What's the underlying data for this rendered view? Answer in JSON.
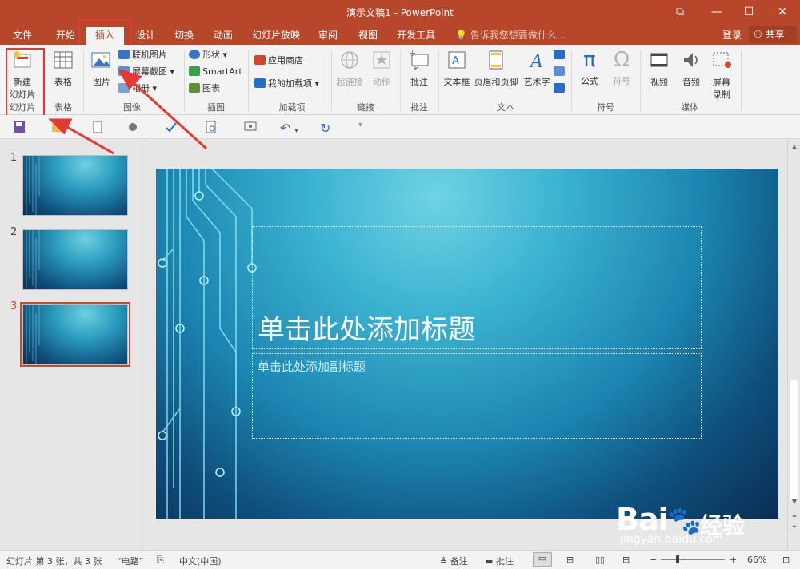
{
  "window": {
    "title": "演示文稿1 - PowerPoint",
    "controls": [
      "⧉",
      "—",
      "☐",
      "✕"
    ]
  },
  "tabs": [
    {
      "label": "文件",
      "active": false
    },
    {
      "label": "开始",
      "active": false
    },
    {
      "label": "插入",
      "active": true
    },
    {
      "label": "设计",
      "active": false
    },
    {
      "label": "切换",
      "active": false
    },
    {
      "label": "动画",
      "active": false
    },
    {
      "label": "幻灯片放映",
      "active": false
    },
    {
      "label": "审阅",
      "active": false
    },
    {
      "label": "视图",
      "active": false
    },
    {
      "label": "开发工具",
      "active": false
    }
  ],
  "tellme": "告诉我您想要做什么...",
  "login": "登录",
  "share": "共享",
  "ribbon": {
    "slides": {
      "new_slide": "新建\n幻灯片",
      "new_slide_line1": "新建",
      "new_slide_line2": "幻灯片",
      "group": "幻灯片"
    },
    "tables": {
      "table": "表格",
      "group": "表格"
    },
    "images": {
      "picture": "图片",
      "online": "联机图片",
      "screenshot": "屏幕截图",
      "album": "相册",
      "group": "图像"
    },
    "illustrations": {
      "shapes": "形状",
      "smartart": "SmartArt",
      "chart": "图表",
      "group": "插图"
    },
    "addins": {
      "store": "应用商店",
      "my_addins": "我的加载项",
      "group": "加载项"
    },
    "links": {
      "hyperlink": "超链接",
      "action": "动作",
      "group": "链接"
    },
    "comments": {
      "comment": "批注",
      "group": "批注"
    },
    "text": {
      "textbox": "文本框",
      "header_footer": "页眉和页脚",
      "wordart": "艺术字",
      "group": "文本"
    },
    "symbols": {
      "equation": "公式",
      "symbol": "符号",
      "group": "符号"
    },
    "media": {
      "video": "视频",
      "audio": "音频",
      "screen_rec_1": "屏幕",
      "screen_rec_2": "录制",
      "group": "媒体"
    }
  },
  "thumbnails": [
    {
      "number": "1",
      "selected": false
    },
    {
      "number": "2",
      "selected": false
    },
    {
      "number": "3",
      "selected": true
    }
  ],
  "slide": {
    "title_placeholder": "单击此处添加标题",
    "subtitle_placeholder": "单击此处添加副标题"
  },
  "statusbar": {
    "slide_info": "幻灯片 第 3 张，共 3 张",
    "theme": "“电路”",
    "language": "中文(中国)",
    "notes": "备注",
    "comments": "批注",
    "zoom": "66%"
  },
  "watermark": {
    "brand": "Bai",
    "brand2": "经验",
    "url": "jingyan.baidu.com"
  },
  "colors": {
    "accent": "#b7472a",
    "highlight": "#e53935",
    "selected_thumb": "#d24726"
  }
}
